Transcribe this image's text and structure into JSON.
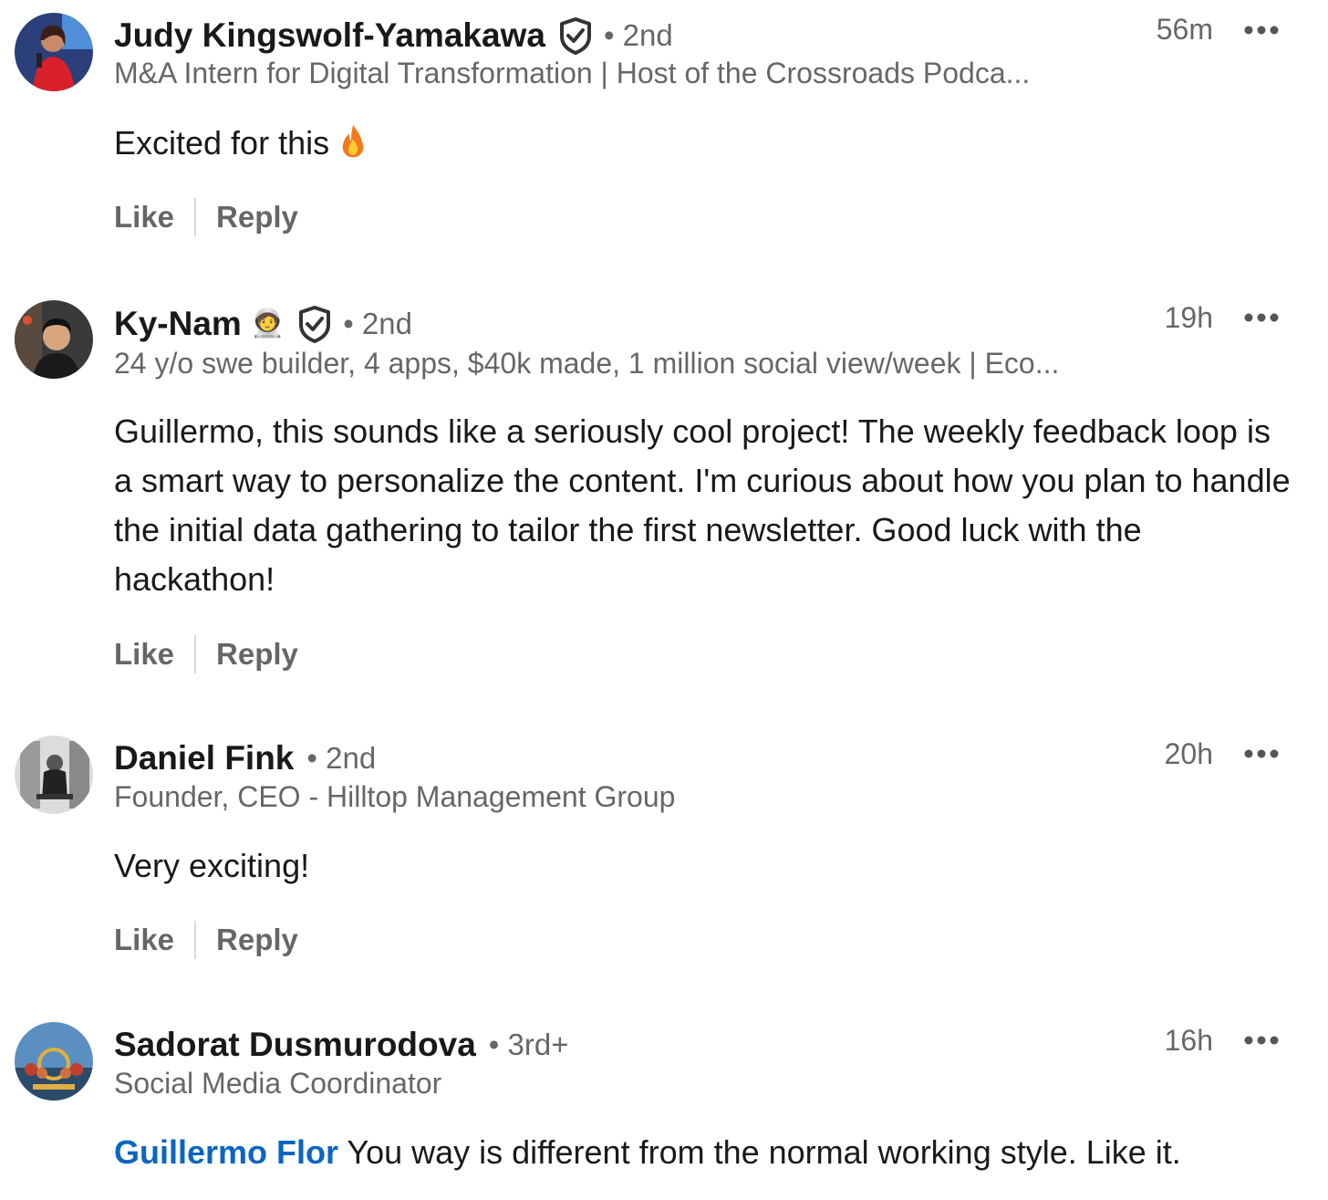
{
  "comments": [
    {
      "author": "Judy Kingswolf-Yamakawa",
      "degree": "• 2nd",
      "verified": true,
      "headline": "M&A Intern for Digital Transformation | Host of the Crossroads Podca...",
      "time": "56m",
      "text": "Excited for this",
      "emoji": "fire-icon",
      "actions": {
        "like": "Like",
        "reply": "Reply"
      }
    },
    {
      "author": "Ky-Nam",
      "badge_emoji": "🧑‍🚀",
      "degree": "• 2nd",
      "verified": true,
      "headline": "24 y/o swe builder, 4 apps, $40k made, 1 million social view/week | Eco...",
      "time": "19h",
      "text": "Guillermo, this sounds like a seriously cool project! The weekly feedback loop is a smart way to personalize the content. I'm curious about how you plan to handle the initial data gathering to tailor the first newsletter. Good luck with the hackathon!",
      "actions": {
        "like": "Like",
        "reply": "Reply"
      }
    },
    {
      "author": "Daniel Fink",
      "degree": "• 2nd",
      "verified": false,
      "headline": "Founder, CEO - Hilltop Management Group",
      "time": "20h",
      "text": "Very exciting!",
      "actions": {
        "like": "Like",
        "reply": "Reply"
      }
    },
    {
      "author": "Sadorat Dusmurodova",
      "degree": "• 3rd+",
      "verified": false,
      "headline": "Social Media Coordinator",
      "time": "16h",
      "mention": "Guillermo Flor",
      "text": " You way is different from the normal working style. Like it."
    }
  ],
  "colors": {
    "mention": "#0a66c2",
    "secondary_text": "#666666",
    "primary_text": "#191919"
  }
}
